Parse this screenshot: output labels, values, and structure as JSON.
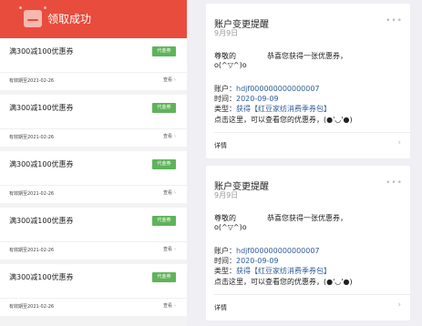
{
  "left": {
    "header_title": "领取成功",
    "coupons": [
      {
        "name": "满300减100优惠券",
        "tag": "代金券",
        "expire": "有效期至2021-02-26",
        "view": "查看"
      },
      {
        "name": "满300减100优惠券",
        "tag": "代金券",
        "expire": "有效期至2021-02-26",
        "view": "查看"
      },
      {
        "name": "满300减100优惠券",
        "tag": "代金券",
        "expire": "有效期至2021-02-26",
        "view": "查看"
      },
      {
        "name": "满300减100优惠券",
        "tag": "代金券",
        "expire": "有效期至2021-02-26",
        "view": "查看"
      },
      {
        "name": "满300减100优惠券",
        "tag": "代金券",
        "expire": "有效期至2021-02-26",
        "view": "查看"
      }
    ]
  },
  "right": {
    "cards": [
      {
        "title": "账户变更提醒",
        "date": "9月9日",
        "greet_a": "尊敬的",
        "greet_b": "恭喜您获得一张优惠券，",
        "emoticon": "o(^▽^)o",
        "account_label": "账户：",
        "account_value": "hdjf000000000000007",
        "time_label": "时间：",
        "time_value": "2020-09-09",
        "type_label": "类型：",
        "type_value": "获得【红豆家纺消费季券包】",
        "tip": "点击这里，可以查看您的优惠券，(●'◡'●)",
        "detail": "详情"
      },
      {
        "title": "账户变更提醒",
        "date": "9月9日",
        "greet_a": "尊敬的",
        "greet_b": "恭喜您获得一张优惠券，",
        "emoticon": "o(^▽^)o",
        "account_label": "账户：",
        "account_value": "hdjf000000000000007",
        "time_label": "时间：",
        "time_value": "2020-09-09",
        "type_label": "类型：",
        "type_value": "获得【红豆家纺消费季券包】",
        "tip": "点击这里，可以查看您的优惠券，(●'◡'●)",
        "detail": "详情"
      }
    ]
  },
  "colors": {
    "header_red": "#e84c3d",
    "tag_green": "#5fb35a",
    "link_blue": "#2e5c9a"
  }
}
